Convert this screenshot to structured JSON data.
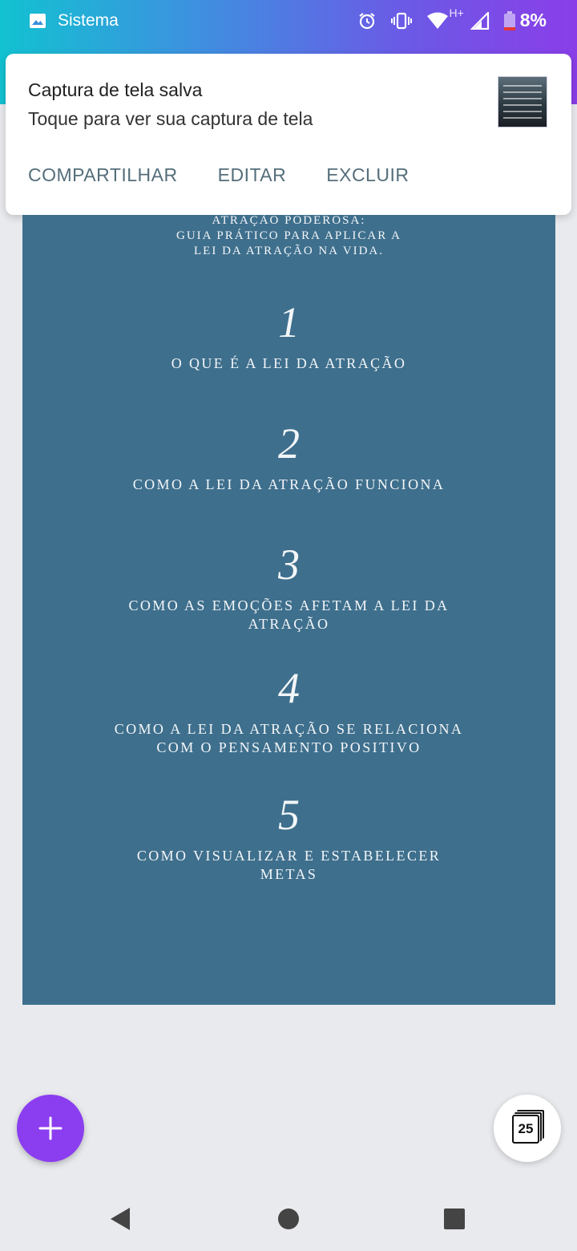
{
  "status_bar": {
    "app_name": "Sistema",
    "network_label": "H+",
    "battery": "8%",
    "icons": [
      "gallery-icon",
      "alarm-icon",
      "vibrate-icon",
      "wifi-icon",
      "signal-icon",
      "battery-icon"
    ]
  },
  "notification": {
    "title": "Captura de tela salva",
    "text": "Toque para ver sua captura de tela",
    "actions": [
      "COMPARTILHAR",
      "EDITAR",
      "EXCLUIR"
    ]
  },
  "document": {
    "header_lines": [
      "ATRAÇÃO PODEROSA:",
      "GUIA PRÁTICO PARA APLICAR A",
      "LEI DA ATRAÇÃO NA VIDA."
    ],
    "items": [
      {
        "number": "1",
        "lines": [
          "O QUE É A LEI DA ATRAÇÃO"
        ]
      },
      {
        "number": "2",
        "lines": [
          "COMO A LEI DA ATRAÇÃO FUNCIONA"
        ]
      },
      {
        "number": "3",
        "lines": [
          "COMO AS EMOÇÕES AFETAM A LEI DA",
          "ATRAÇÃO"
        ]
      },
      {
        "number": "4",
        "lines": [
          "COMO A LEI DA ATRAÇÃO SE RELACIONA",
          "COM O PENSAMENTO POSITIVO"
        ]
      },
      {
        "number": "5",
        "lines": [
          "COMO VISUALIZAR E ESTABELECER",
          "METAS"
        ]
      }
    ]
  },
  "page_count": "25",
  "colors": {
    "accent": "#8b3df0",
    "document_bg": "#3e6f8d",
    "action_text": "#546e7a"
  }
}
